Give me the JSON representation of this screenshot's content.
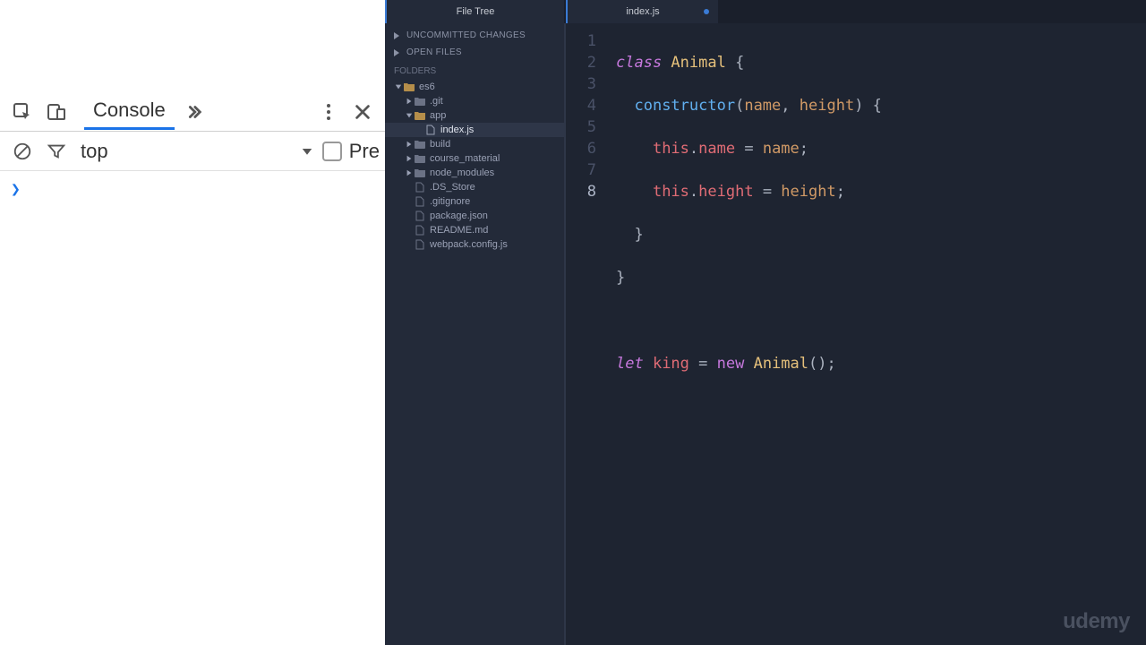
{
  "devtools": {
    "tab_label": "Console",
    "context": "top",
    "preserve_label": "Pre"
  },
  "editor_tabs": {
    "filetree": "File Tree",
    "file": "index.js"
  },
  "sidebar": {
    "uncommitted": "Uncommitted Changes",
    "open_files": "Open Files",
    "folders_heading": "Folders",
    "items": {
      "root": "es6",
      "git": ".git",
      "app": "app",
      "indexjs": "index.js",
      "build": "build",
      "course_material": "course_material",
      "node_modules": "node_modules",
      "ds_store": ".DS_Store",
      "gitignore": ".gitignore",
      "packagejson": "package.json",
      "readme": "README.md",
      "webpack": "webpack.config.js"
    }
  },
  "code": {
    "lines": [
      "1",
      "2",
      "3",
      "4",
      "5",
      "6",
      "7",
      "8"
    ],
    "l1": {
      "class": "class ",
      "name": "Animal",
      "open": " {"
    },
    "l2": {
      "fn": "constructor",
      "p1": "name",
      "comma": ", ",
      "p2": "height",
      "rest": ") {"
    },
    "l3": {
      "this": "this",
      "dot": ".",
      "prop": "name",
      "eq": " = ",
      "rhs": "name",
      "semi": ";"
    },
    "l4": {
      "this": "this",
      "dot": ".",
      "prop": "height",
      "eq": " = ",
      "rhs": "height",
      "semi": ";"
    },
    "l5": "  }",
    "l6": "}",
    "l8": {
      "let": "let ",
      "var": "king",
      "eq": " = ",
      "new": "new ",
      "cls": "Animal",
      "rest": "();"
    }
  },
  "watermark": "udemy"
}
